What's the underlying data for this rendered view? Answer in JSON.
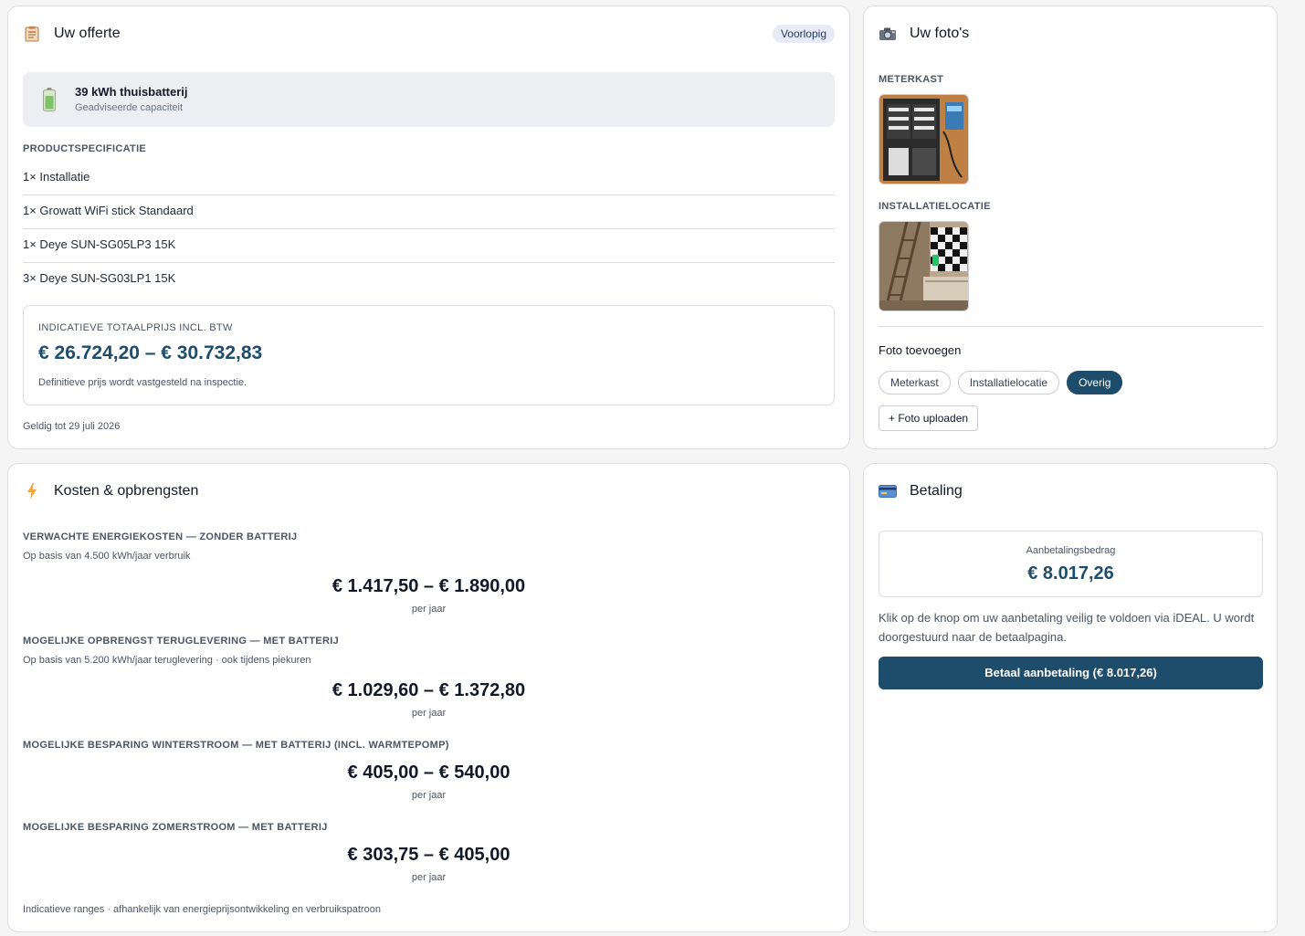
{
  "offer": {
    "title": "Uw offerte",
    "status_badge": "Voorlopig",
    "product": {
      "name": "39 kWh thuisbatterij",
      "subtitle": "Geadviseerde capaciteit"
    },
    "spec_label": "PRODUCTSPECIFICATIE",
    "specs": [
      "1× Installatie",
      "1× Growatt WiFi stick Standaard",
      "1× Deye SUN-SG05LP3 15K",
      "3× Deye SUN-SG03LP1 15K"
    ],
    "price": {
      "label": "INDICATIEVE TOTAALPRIJS INCL. BTW",
      "range": "€ 26.724,20 – € 30.732,83",
      "note": "Definitieve prijs wordt vastgesteld na inspectie."
    },
    "valid_until": "Geldig tot 29 juli 2026"
  },
  "photos": {
    "title": "Uw foto's",
    "meterkast_label": "METERKAST",
    "installatie_label": "INSTALLATIELOCATIE",
    "add_label": "Foto toevoegen",
    "chips": [
      "Meterkast",
      "Installatielocatie",
      "Overig"
    ],
    "active_chip": "Overig",
    "upload_label": "+ Foto uploaden"
  },
  "costs": {
    "title": "Kosten & opbrengsten",
    "items": [
      {
        "title": "VERWACHTE ENERGIEKOSTEN — ZONDER BATTERIJ",
        "subtitle": "Op basis van 4.500 kWh/jaar verbruik",
        "value": "€ 1.417,50 – € 1.890,00",
        "unit": "per jaar"
      },
      {
        "title": "MOGELIJKE OPBRENGST TERUGLEVERING — MET BATTERIJ",
        "subtitle": "Op basis van 5.200 kWh/jaar teruglevering · ook tijdens piekuren",
        "value": "€ 1.029,60 – € 1.372,80",
        "unit": "per jaar"
      },
      {
        "title": "MOGELIJKE BESPARING WINTERSTROOM — MET BATTERIJ (INCL. WARMTEPOMP)",
        "subtitle": "",
        "value": "€ 405,00 – € 540,00",
        "unit": "per jaar"
      },
      {
        "title": "MOGELIJKE BESPARING ZOMERSTROOM — MET BATTERIJ",
        "subtitle": "",
        "value": "€ 303,75 – € 405,00",
        "unit": "per jaar"
      }
    ],
    "footer": "Indicatieve ranges · afhankelijk van energieprijsontwikkeling en verbruikspatroon"
  },
  "payment": {
    "title": "Betaling",
    "amount_label": "Aanbetalingsbedrag",
    "amount": "€ 8.017,26",
    "description": "Klik op de knop om uw aanbetaling veilig te voldoen via iDEAL. U wordt doorgestuurd naar de betaalpagina.",
    "button_label": "Betaal aanbetaling (€ 8.017,26)"
  },
  "colors": {
    "accent": "#1e4d6b",
    "badge_bg": "#e8ebf5",
    "card_border": "#dcdde2",
    "page_bg": "#f5f5f6"
  },
  "icons": {
    "offer": "clipboard-icon",
    "photos": "camera-icon",
    "costs": "lightning-icon",
    "payment": "credit-card-icon",
    "product": "battery-icon"
  }
}
